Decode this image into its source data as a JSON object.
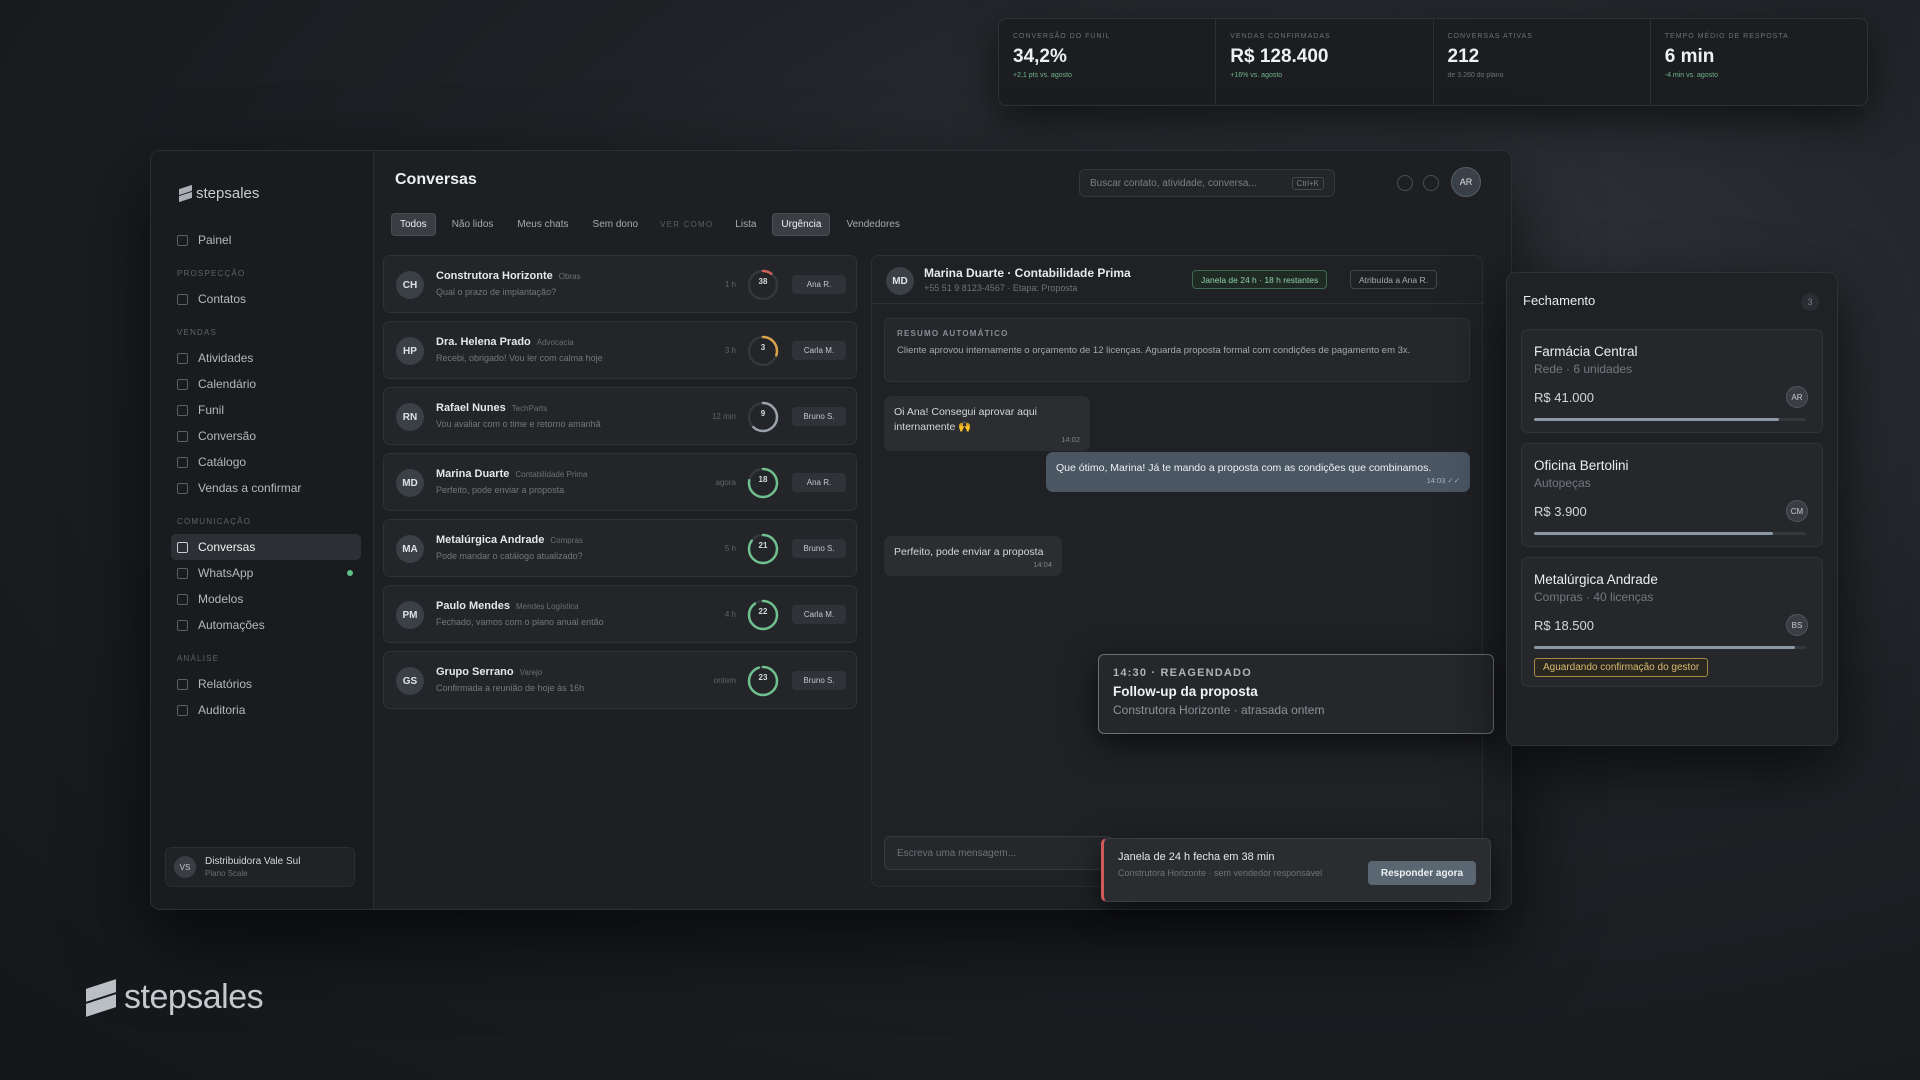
{
  "kpis": [
    {
      "label": "Conversão do funil",
      "value": "34,2%",
      "sub": "+2,1 pts vs. agosto",
      "sub_style": "pos"
    },
    {
      "label": "Vendas confirmadas",
      "value": "R$ 128.400",
      "sub": "+16% vs. agosto",
      "sub_style": "pos"
    },
    {
      "label": "Conversas ativas",
      "value": "212",
      "sub": "de 3.260 do plano",
      "sub_style": "muted"
    },
    {
      "label": "Tempo médio de resposta",
      "value": "6 min",
      "sub": "-4 min vs. agosto",
      "sub_style": "pos"
    }
  ],
  "sidebar": {
    "logo": "stepsales",
    "top_item": "Painel",
    "sections": [
      {
        "title": "PROSPECÇÃO",
        "items": [
          "Contatos"
        ]
      },
      {
        "title": "VENDAS",
        "items": [
          "Atividades",
          "Calendário",
          "Funil",
          "Conversão",
          "Catálogo",
          "Vendas a confirmar"
        ]
      },
      {
        "title": "COMUNICAÇÃO",
        "items": [
          "Conversas",
          "WhatsApp",
          "Modelos",
          "Automações"
        ]
      },
      {
        "title": "ANÁLISE",
        "items": [
          "Relatórios",
          "Auditoria"
        ]
      }
    ],
    "active_item": "Conversas",
    "org_initials": "VS",
    "org_name": "Distribuidora Vale Sul",
    "org_plan": "Plano Scale"
  },
  "header": {
    "title": "Conversas",
    "search_placeholder": "Buscar contato, atividade, conversa...",
    "search_kbd": "Ctrl+K",
    "user_initials": "AR"
  },
  "tabs": {
    "filters": [
      "Todos",
      "Não lidos",
      "Meus chats",
      "Sem dono"
    ],
    "view_label": "VER COMO",
    "views": [
      "Lista",
      "Urgência",
      "Vendedores"
    ],
    "active_filter": "Todos",
    "active_view": "Urgência"
  },
  "conversations": [
    {
      "initials": "CH",
      "name": "Construtora Horizonte",
      "tag": "Obras",
      "preview": "Qual o prazo de implantação?",
      "time": "1 h",
      "sla": "38",
      "sla_unit": "min",
      "progress": 0.1,
      "color": "#d0605a",
      "owner": "Ana R."
    },
    {
      "initials": "HP",
      "name": "Dra. Helena Prado",
      "tag": "Advocacia",
      "preview": "Recebi, obrigado! Vou ler com calma hoje",
      "time": "3 h",
      "sla": "3",
      "sla_unit": "h",
      "progress": 0.3,
      "color": "#d9a24a",
      "owner": "Carla M."
    },
    {
      "initials": "RN",
      "name": "Rafael Nunes",
      "tag": "TechParts",
      "preview": "Vou avaliar com o time e retorno amanhã",
      "time": "12 min",
      "sla": "9",
      "sla_unit": "h",
      "progress": 0.62,
      "color": "#9aa2aa",
      "owner": "Bruno S."
    },
    {
      "initials": "MD",
      "name": "Marina Duarte",
      "tag": "Contabilidade Prima",
      "preview": "Perfeito, pode enviar a proposta",
      "time": "agora",
      "sla": "18",
      "sla_unit": "h",
      "progress": 0.78,
      "color": "#6fc08e",
      "owner": "Ana R."
    },
    {
      "initials": "MA",
      "name": "Metalúrgica Andrade",
      "tag": "Compras",
      "preview": "Pode mandar o catálogo atualizado?",
      "time": "5 h",
      "sla": "21",
      "sla_unit": "h",
      "progress": 0.85,
      "color": "#6fc08e",
      "owner": "Bruno S."
    },
    {
      "initials": "PM",
      "name": "Paulo Mendes",
      "tag": "Mendes Logística",
      "preview": "Fechado, vamos com o plano anual então",
      "time": "4 h",
      "sla": "22",
      "sla_unit": "h",
      "progress": 0.9,
      "color": "#6fc08e",
      "owner": "Carla M."
    },
    {
      "initials": "GS",
      "name": "Grupo Serrano",
      "tag": "Varejo",
      "preview": "Confirmada a reunião de hoje às 16h",
      "time": "ontem",
      "sla": "23",
      "sla_unit": "h",
      "progress": 0.95,
      "color": "#6fc08e",
      "owner": "Bruno S."
    }
  ],
  "chat": {
    "initials": "MD",
    "name": "Marina Duarte · Contabilidade Prima",
    "sub": "+55 51 9 8123-4567 · Etapa: Proposta",
    "window_pill": "Janela de 24 h · 18 h restantes",
    "assigned_pill": "Atribuída a Ana R.",
    "summary_label": "RESUMO AUTOMÁTICO",
    "summary_text": "Cliente aprovou internamente o orçamento de 12 licenças. Aguarda proposta formal com condições de pagamento em 3x.",
    "messages": [
      {
        "dir": "in",
        "text": "Oi Ana! Consegui aprovar aqui internamente 🙌",
        "time": "14:02"
      },
      {
        "dir": "out",
        "text": "Que ótimo, Marina! Já te mando a proposta com as condições que combinamos.",
        "time": "14:03 ✓✓"
      },
      {
        "dir": "in",
        "text": "Perfeito, pode enviar a proposta",
        "time": "14:04"
      }
    ],
    "composer_placeholder": "Escreva uma mensagem..."
  },
  "followup": {
    "label": "14:30 · REAGENDADO",
    "title": "Follow-up da proposta",
    "sub": "Construtora Horizonte · atrasada ontem"
  },
  "alert": {
    "title": "Janela de 24 h fecha em 38 min",
    "sub": "Construtora Horizonte · sem vendedor responsável",
    "button": "Responder agora"
  },
  "fechamento": {
    "title": "Fechamento",
    "count": "3",
    "deals": [
      {
        "name": "Farmácia Central",
        "sub": "Rede · 6 unidades",
        "value": "R$ 41.000",
        "owner": "AR",
        "progress": 0.9,
        "badge": ""
      },
      {
        "name": "Oficina Bertolini",
        "sub": "Autopeças",
        "value": "R$ 3.900",
        "owner": "CM",
        "progress": 0.88,
        "badge": ""
      },
      {
        "name": "Metalúrgica Andrade",
        "sub": "Compras · 40 licenças",
        "value": "R$ 18.500",
        "owner": "BS",
        "progress": 0.96,
        "badge": "Aguardando confirmação do gestor"
      }
    ]
  },
  "brand": "stepsales"
}
